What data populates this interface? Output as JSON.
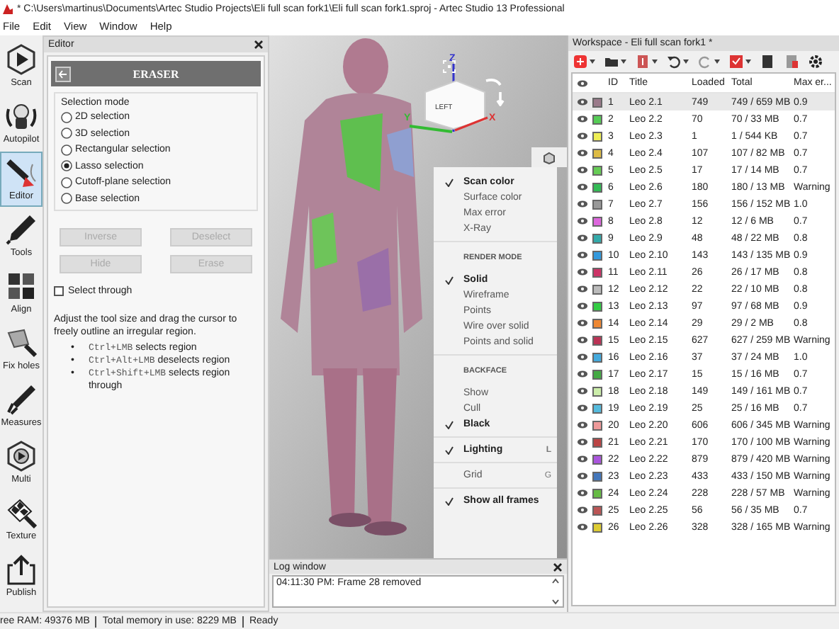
{
  "window": {
    "title": "* C:\\Users\\martinus\\Documents\\Artec Studio Projects\\Eli full scan fork1\\Eli full scan fork1.sproj - Artec Studio 13 Professional"
  },
  "menu": [
    "File",
    "Edit",
    "View",
    "Window",
    "Help"
  ],
  "tool_sidebar": [
    {
      "label": "Scan",
      "selected": false
    },
    {
      "label": "Autopilot",
      "selected": false
    },
    {
      "label": "Editor",
      "selected": true
    },
    {
      "label": "Tools",
      "selected": false
    },
    {
      "label": "Align",
      "selected": false
    },
    {
      "label": "Fix holes",
      "selected": false
    },
    {
      "label": "Measures",
      "selected": false
    },
    {
      "label": "Multi",
      "selected": false
    },
    {
      "label": "Texture",
      "selected": false
    },
    {
      "label": "Publish",
      "selected": false
    }
  ],
  "editor": {
    "title": "Editor",
    "tool": "ERASER",
    "selection_mode": {
      "title": "Selection mode",
      "options": [
        {
          "label": "2D selection",
          "selected": false
        },
        {
          "label": "3D selection",
          "selected": false
        },
        {
          "label": "Rectangular selection",
          "selected": false
        },
        {
          "label": "Lasso selection",
          "selected": true
        },
        {
          "label": "Cutoff-plane selection",
          "selected": false
        },
        {
          "label": "Base selection",
          "selected": false
        }
      ]
    },
    "buttons": [
      {
        "label": "Inverse",
        "disabled": true
      },
      {
        "label": "Deselect",
        "disabled": true
      },
      {
        "label": "Hide",
        "disabled": true
      },
      {
        "label": "Erase",
        "disabled": true
      }
    ],
    "select_through": {
      "label": "Select through",
      "checked": false
    },
    "help": "Adjust the tool size and drag the cursor to freely outline an irregular region.",
    "hints": [
      {
        "bullet": "•",
        "keys": "Ctrl+LMB",
        "text": "selects region"
      },
      {
        "bullet": "•",
        "keys": "Ctrl+Alt+LMB",
        "text": "deselects region"
      },
      {
        "bullet": "•",
        "keys": "Ctrl+Shift+LMB",
        "text": "selects region through"
      }
    ]
  },
  "viewport": {
    "view_cube": {
      "face": "LEFT",
      "x": "X",
      "y": "Y",
      "z": "Z"
    },
    "display_menu": [
      {
        "items": [
          {
            "label": "Scan color",
            "checked": true
          },
          {
            "label": "Surface color",
            "checked": false
          },
          {
            "label": "Max error",
            "checked": false
          },
          {
            "label": "X-Ray",
            "checked": false
          }
        ]
      },
      {
        "heading": "RENDER MODE",
        "items": [
          {
            "label": "Solid",
            "checked": true
          },
          {
            "label": "Wireframe",
            "checked": false
          },
          {
            "label": "Points",
            "checked": false
          },
          {
            "label": "Wire over solid",
            "checked": false
          },
          {
            "label": "Points and solid",
            "checked": false
          }
        ]
      },
      {
        "heading": "BACKFACE",
        "items": [
          {
            "label": "Show",
            "checked": false
          },
          {
            "label": "Cull",
            "checked": false
          },
          {
            "label": "Black",
            "checked": true
          }
        ]
      },
      {
        "items": [
          {
            "label": "Lighting",
            "checked": true,
            "shortcut": "L"
          }
        ]
      },
      {
        "items": [
          {
            "label": "Grid",
            "checked": false,
            "shortcut": "G"
          }
        ]
      },
      {
        "items": [
          {
            "label": "Show all frames",
            "checked": true
          }
        ]
      }
    ]
  },
  "log_window": {
    "title": "Log window",
    "lines": [
      "04:11:30 PM: Frame 28 removed"
    ]
  },
  "workspace": {
    "title": "Workspace - Eli full scan fork1 *",
    "columns": [
      "ID",
      "Title",
      "Loaded",
      "Total",
      "Max er..."
    ],
    "rows": [
      {
        "id": "1",
        "title": "Leo 2.1",
        "loaded": "749",
        "total": "749 / 659 MB",
        "max_error": "0.9",
        "color": "#9a7a8a",
        "selected": true
      },
      {
        "id": "2",
        "title": "Leo 2.2",
        "loaded": "70",
        "total": "70 / 33 MB",
        "max_error": "0.7",
        "color": "#55cc55",
        "selected": false
      },
      {
        "id": "3",
        "title": "Leo 2.3",
        "loaded": "1",
        "total": "1 / 544 KB",
        "max_error": "0.7",
        "color": "#eeee55",
        "selected": false
      },
      {
        "id": "4",
        "title": "Leo 2.4",
        "loaded": "107",
        "total": "107 / 82 MB",
        "max_error": "0.7",
        "color": "#ddbb44",
        "selected": false
      },
      {
        "id": "5",
        "title": "Leo 2.5",
        "loaded": "17",
        "total": "17 / 14 MB",
        "max_error": "0.7",
        "color": "#66cc55",
        "selected": false
      },
      {
        "id": "6",
        "title": "Leo 2.6",
        "loaded": "180",
        "total": "180 / 13 MB",
        "max_error": "Warning",
        "color": "#33bb55",
        "selected": false
      },
      {
        "id": "7",
        "title": "Leo 2.7",
        "loaded": "156",
        "total": "156 / 152 MB",
        "max_error": "1.0",
        "color": "#999999",
        "selected": false
      },
      {
        "id": "8",
        "title": "Leo 2.8",
        "loaded": "12",
        "total": "12 / 6 MB",
        "max_error": "0.7",
        "color": "#dd66dd",
        "selected": false
      },
      {
        "id": "9",
        "title": "Leo 2.9",
        "loaded": "48",
        "total": "48 / 22 MB",
        "max_error": "0.8",
        "color": "#33aaaa",
        "selected": false
      },
      {
        "id": "10",
        "title": "Leo 2.10",
        "loaded": "143",
        "total": "143 / 135 MB",
        "max_error": "0.9",
        "color": "#3399dd",
        "selected": false
      },
      {
        "id": "11",
        "title": "Leo 2.11",
        "loaded": "26",
        "total": "26 / 17 MB",
        "max_error": "0.8",
        "color": "#cc3366",
        "selected": false
      },
      {
        "id": "12",
        "title": "Leo 2.12",
        "loaded": "22",
        "total": "22 / 10 MB",
        "max_error": "0.8",
        "color": "#bbbbbb",
        "selected": false
      },
      {
        "id": "13",
        "title": "Leo 2.13",
        "loaded": "97",
        "total": "97 / 68 MB",
        "max_error": "0.9",
        "color": "#33cc44",
        "selected": false
      },
      {
        "id": "14",
        "title": "Leo 2.14",
        "loaded": "29",
        "total": "29 / 2 MB",
        "max_error": "0.8",
        "color": "#ee8833",
        "selected": false
      },
      {
        "id": "15",
        "title": "Leo 2.15",
        "loaded": "627",
        "total": "627 / 259 MB",
        "max_error": "Warning",
        "color": "#bb3355",
        "selected": false
      },
      {
        "id": "16",
        "title": "Leo 2.16",
        "loaded": "37",
        "total": "37 / 24 MB",
        "max_error": "1.0",
        "color": "#44aadd",
        "selected": false
      },
      {
        "id": "17",
        "title": "Leo 2.17",
        "loaded": "15",
        "total": "15 / 16 MB",
        "max_error": "0.7",
        "color": "#44aa44",
        "selected": false
      },
      {
        "id": "18",
        "title": "Leo 2.18",
        "loaded": "149",
        "total": "149 / 161 MB",
        "max_error": "0.7",
        "color": "#cceeaa",
        "selected": false
      },
      {
        "id": "19",
        "title": "Leo 2.19",
        "loaded": "25",
        "total": "25 / 16 MB",
        "max_error": "0.7",
        "color": "#55bbdd",
        "selected": false
      },
      {
        "id": "20",
        "title": "Leo 2.20",
        "loaded": "606",
        "total": "606 / 345 MB",
        "max_error": "Warning",
        "color": "#ee9999",
        "selected": false
      },
      {
        "id": "21",
        "title": "Leo 2.21",
        "loaded": "170",
        "total": "170 / 100 MB",
        "max_error": "Warning",
        "color": "#bb4444",
        "selected": false
      },
      {
        "id": "22",
        "title": "Leo 2.22",
        "loaded": "879",
        "total": "879 / 420 MB",
        "max_error": "Warning",
        "color": "#aa55dd",
        "selected": false
      },
      {
        "id": "23",
        "title": "Leo 2.23",
        "loaded": "433",
        "total": "433 / 150 MB",
        "max_error": "Warning",
        "color": "#4477bb",
        "selected": false
      },
      {
        "id": "24",
        "title": "Leo 2.24",
        "loaded": "228",
        "total": "228 / 57 MB",
        "max_error": "Warning",
        "color": "#66bb44",
        "selected": false
      },
      {
        "id": "25",
        "title": "Leo 2.25",
        "loaded": "56",
        "total": "56 / 35 MB",
        "max_error": "0.7",
        "color": "#bb5555",
        "selected": false
      },
      {
        "id": "26",
        "title": "Leo 2.26",
        "loaded": "328",
        "total": "328 / 165 MB",
        "max_error": "Warning",
        "color": "#ddcc33",
        "selected": false
      }
    ]
  },
  "status_bar": [
    "ree RAM: 49376 MB",
    "Total memory in use: 8229 MB",
    "Ready"
  ]
}
